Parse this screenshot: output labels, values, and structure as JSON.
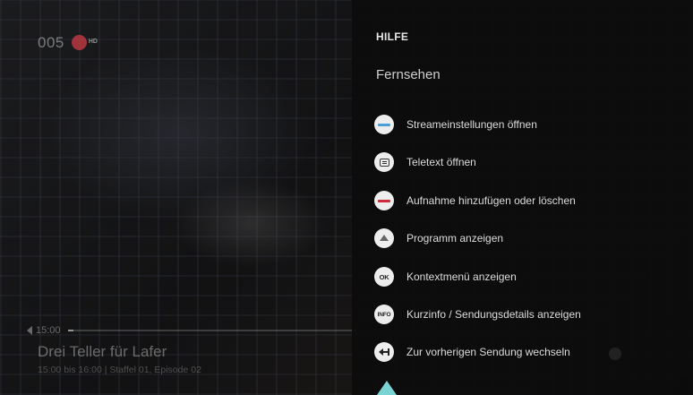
{
  "channel": {
    "number": "005",
    "logo_badge": "HD"
  },
  "player": {
    "time": "15:00",
    "progress_fraction": 0.02,
    "show_title": "Drei Teller für Lafer",
    "show_meta": "15:00 bis 16:00 | Staffel 01, Episode 02"
  },
  "help": {
    "title": "HILFE",
    "section": "Fernsehen",
    "items": [
      {
        "icon": "blue-button-icon",
        "icon_color": "#4a9fd8",
        "label": "Streameinstellungen öffnen"
      },
      {
        "icon": "teletext-icon",
        "label": "Teletext öffnen"
      },
      {
        "icon": "red-button-icon",
        "icon_color": "#d0293a",
        "label": "Aufnahme hinzufügen oder löschen"
      },
      {
        "icon": "up-triangle-icon",
        "label": "Programm anzeigen"
      },
      {
        "icon": "ok-button-icon",
        "icon_text": "OK",
        "label": "Kontextmenü anzeigen"
      },
      {
        "icon": "info-button-icon",
        "icon_text": "INFO",
        "label": "Kurzinfo / Sendungsdetails anzeigen"
      },
      {
        "icon": "back-arrow-icon",
        "label": "Zur vorherigen Sendung wechseln"
      }
    ]
  },
  "scroll_indicator_color": "#7ad4d4"
}
